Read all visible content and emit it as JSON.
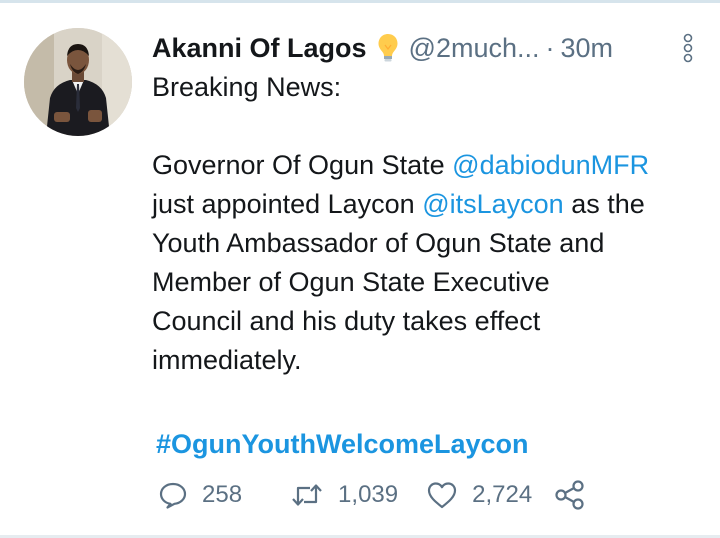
{
  "tweet": {
    "author": {
      "display_name": "Akanni Of Lagos",
      "handle": "@2much...",
      "badge_icon": "lightbulb-icon"
    },
    "separator": "·",
    "time": "30m",
    "body": {
      "line1": "Breaking News:",
      "p2_part1": "Governor Of Ogun State ",
      "mention1": "@dabiodunMFR",
      "p2_part2": " just appointed Laycon ",
      "mention2": "@itsLaycon",
      "p2_part3": " as the Youth Ambassador of Ogun State and Member of Ogun State Executive Council and his duty takes effect immediately."
    },
    "hashtag": "#OgunYouthWelcomeLaycon",
    "stats": {
      "replies": "258",
      "retweets": "1,039",
      "likes": "2,724"
    }
  },
  "colors": {
    "link": "#1b95e0",
    "muted": "#5b7083",
    "text": "#14171a",
    "background": "#ffffff"
  }
}
